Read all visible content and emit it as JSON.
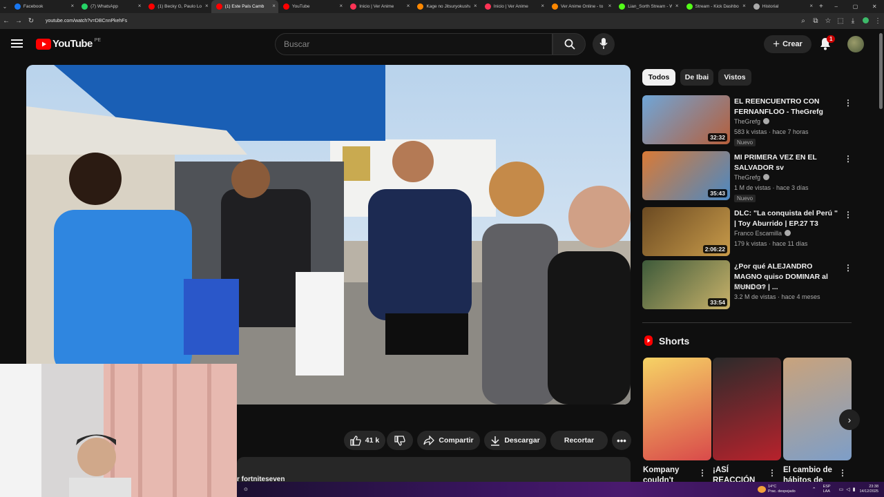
{
  "browser": {
    "tabs": [
      {
        "label": "Facebook",
        "color": "#1877f2"
      },
      {
        "label": "(7) WhatsApp",
        "color": "#25d366"
      },
      {
        "label": "(1) Becky G, Paulo Lon",
        "color": "#ff0000"
      },
      {
        "label": "(1) Este País Camb",
        "color": "#ff0000",
        "active": true
      },
      {
        "label": "YouTube",
        "color": "#ff0000"
      },
      {
        "label": "Inicio | Ver Anime",
        "color": "#ff3355"
      },
      {
        "label": "Kage no Jitsuryokusha",
        "color": "#ff8800"
      },
      {
        "label": "Inicio | Ver Anime",
        "color": "#ff3355"
      },
      {
        "label": "Ver Anime Online - to",
        "color": "#ff8800"
      },
      {
        "label": "Lian_Sorth Stream - W",
        "color": "#53fc18"
      },
      {
        "label": "Stream - Kick Dashbo",
        "color": "#53fc18"
      },
      {
        "label": "Historial",
        "color": "#aaaaaa"
      }
    ],
    "url": "youtube.com/watch?v=DBCnnPkehFs",
    "tab_close": "×",
    "new_tab": "+"
  },
  "header": {
    "logo_text": "YouTube",
    "region": "PE",
    "search_placeholder": "Buscar",
    "create_label": "Crear",
    "notif_count": "1"
  },
  "actions": {
    "likes": "41 k",
    "share": "Compartir",
    "download": "Descargar",
    "clip": "Recortar"
  },
  "description_snippet": "r fortniteseven",
  "chips": [
    "Todos",
    "De Ibai",
    "Vistos"
  ],
  "recommendations": [
    {
      "title": "EL REENCUENTRO CON FERNANFLOO - TheGrefg",
      "channel": "TheGrefg",
      "verified": true,
      "meta": "583 k vistas · hace 7 horas",
      "badge": "Nuevo",
      "duration": "32:32",
      "colors": [
        "#6fa6d8",
        "#b65e3a"
      ]
    },
    {
      "title": "MI PRIMERA VEZ EN EL SALVADOR sv",
      "channel": "TheGrefg",
      "verified": true,
      "meta": "1 M de vistas · hace 3 días",
      "badge": "Nuevo",
      "duration": "35:43",
      "colors": [
        "#d97a36",
        "#4b89c4"
      ]
    },
    {
      "title": "DLC: \"La conquista del Perú \" | Toy Aburrido | EP.27 T3",
      "channel": "Franco Escamilla",
      "verified": true,
      "meta": "179 k vistas · hace 11 días",
      "badge": "",
      "duration": "2:06:22",
      "colors": [
        "#6b4a22",
        "#c89b4a"
      ]
    },
    {
      "title": "¿Por qué ALEJANDRO MAGNO quiso DOMINAR al MUNDO? | ...",
      "channel": "Dieck Docs",
      "verified": false,
      "meta": "3.2 M de vistas · hace 4 meses",
      "badge": "",
      "duration": "33:54",
      "colors": [
        "#3d5a3a",
        "#c9b26a"
      ]
    }
  ],
  "shorts": {
    "heading": "Shorts",
    "items": [
      {
        "title": "Kompany couldn't",
        "colors": [
          "#f6d365",
          "#d94a4a"
        ]
      },
      {
        "title": "¡ASÍ REACCIÓN",
        "colors": [
          "#2b2b2b",
          "#b8222c"
        ]
      },
      {
        "title": "El cambio de hábitos de",
        "colors": [
          "#c9a37c",
          "#7d9ec8"
        ]
      }
    ]
  },
  "taskbar": {
    "weather_temp": "14°C",
    "weather_desc": "Prac. despejado",
    "lang1": "ESP",
    "lang2": "LAA",
    "time": "23:38",
    "date": "14/12/2025"
  }
}
